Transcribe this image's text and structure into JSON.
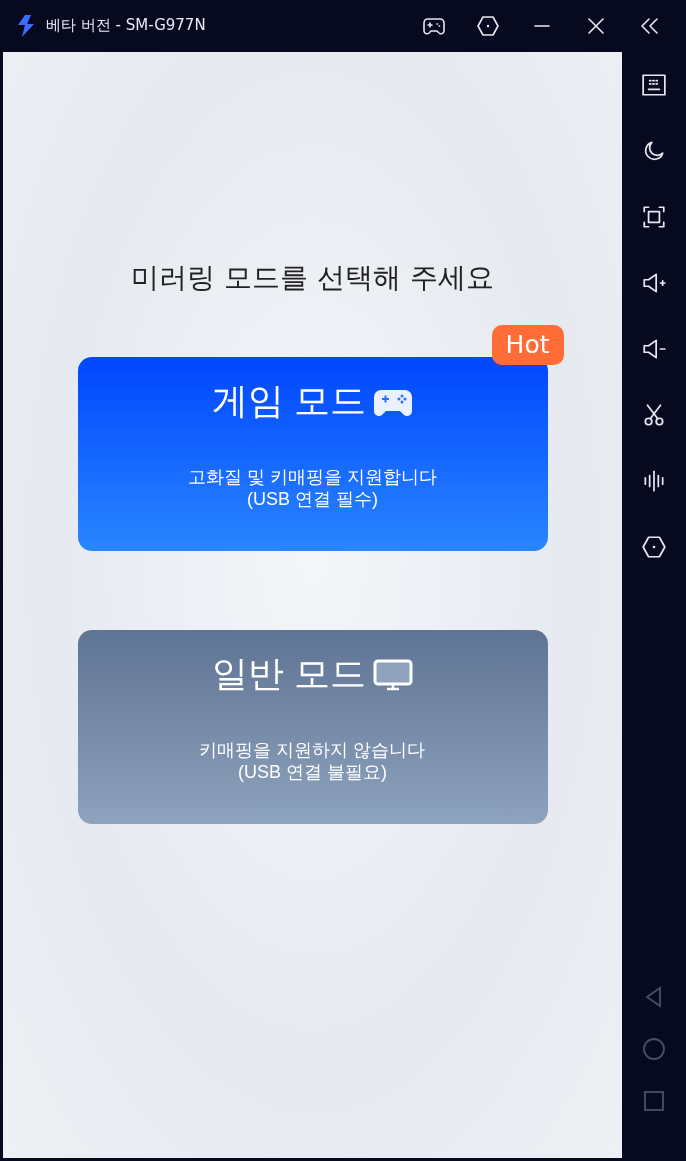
{
  "window": {
    "title": "베타 버전 - SM-G977N"
  },
  "heading": "미러링 모드를 선택해 주세요",
  "modes": [
    {
      "kind": "game",
      "title": "게임 모드",
      "badge": "Hot",
      "description_lines": [
        "고화질 및 키매핑을 지원합니다",
        "(USB 연결 필수)"
      ]
    },
    {
      "kind": "normal",
      "title": "일반 모드",
      "description_lines": [
        "키매핑을 지원하지 않습니다",
        "(USB 연결 불필요)"
      ]
    }
  ]
}
